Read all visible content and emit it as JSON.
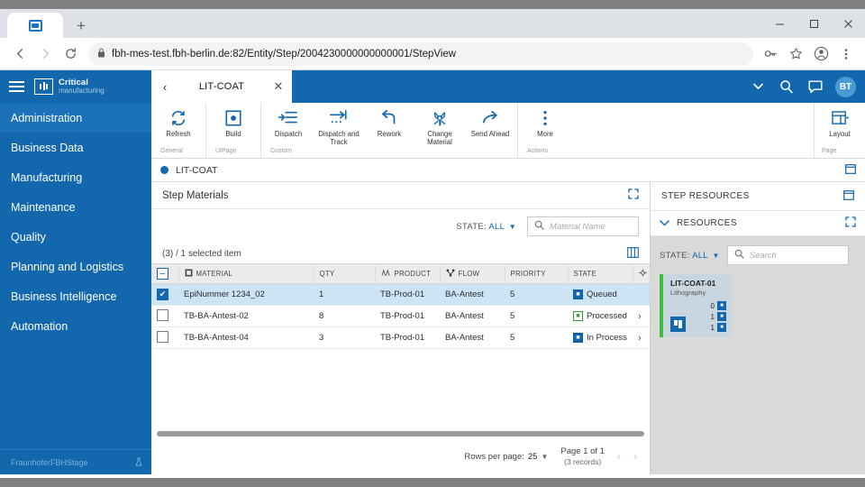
{
  "browser": {
    "tab_favicon": "app-favicon",
    "new_tab_label": "+",
    "window_controls": [
      "minimize",
      "maximize",
      "close"
    ],
    "url": "fbh-mes-test.fbh-berlin.de:82/Entity/Step/2004230000000000001/StepView",
    "lock_icon": "lock-icon",
    "nav": {
      "back": "back-icon",
      "forward": "forward-icon",
      "reload": "reload-icon"
    },
    "omni_icons": [
      "key-icon",
      "star-icon",
      "profile-icon",
      "menu-icon"
    ]
  },
  "sidebar": {
    "logo": {
      "line1": "Critical",
      "line2": "manufacturing"
    },
    "items": [
      {
        "label": "Administration",
        "active": true
      },
      {
        "label": "Business Data",
        "active": false
      },
      {
        "label": "Manufacturing",
        "active": false
      },
      {
        "label": "Maintenance",
        "active": false
      },
      {
        "label": "Quality",
        "active": false
      },
      {
        "label": "Planning and Logistics",
        "active": false
      },
      {
        "label": "Business Intelligence",
        "active": false
      },
      {
        "label": "Automation",
        "active": false
      }
    ],
    "footer": {
      "label": "FraunhoferFBHStage",
      "icon": "flask-icon"
    }
  },
  "topbar": {
    "tab_title": "LIT-COAT",
    "back_icon": "chevron-left-icon",
    "close_icon": "close-icon",
    "chevron_icon": "chevron-down-icon",
    "search_icon": "search-icon",
    "chat_icon": "chat-icon",
    "avatar_initials": "BT"
  },
  "ribbon": {
    "groups": [
      {
        "group_label": "General",
        "buttons": [
          {
            "label": "Refresh",
            "icon": "refresh-icon"
          }
        ]
      },
      {
        "group_label": "UIPage",
        "buttons": [
          {
            "label": "Build",
            "icon": "build-icon"
          }
        ]
      },
      {
        "group_label": "Custom",
        "buttons": [
          {
            "label": "Dispatch",
            "icon": "dispatch-icon"
          },
          {
            "label": "Dispatch and Track",
            "icon": "dispatch-track-icon"
          },
          {
            "label": "Rework",
            "icon": "rework-icon"
          },
          {
            "label": "Change Material",
            "icon": "change-material-icon"
          },
          {
            "label": "Send Ahead",
            "icon": "send-ahead-icon"
          }
        ]
      },
      {
        "group_label": "Actions",
        "buttons": [
          {
            "label": "More",
            "icon": "more-vertical-icon"
          }
        ]
      }
    ],
    "page_group": {
      "group_label": "Page",
      "buttons": [
        {
          "label": "Layout",
          "icon": "layout-icon"
        }
      ]
    }
  },
  "entity_header": {
    "name": "LIT-COAT",
    "status_dot_color": "#1267ad",
    "right_icon": "panel-icon"
  },
  "materials_panel": {
    "title": "Step Materials",
    "expand_icon": "expand-icon",
    "state_filter": {
      "prefix": "STATE:",
      "value": "ALL",
      "caret": "caret-down-icon"
    },
    "search": {
      "placeholder": "Material Name",
      "value": "",
      "icon": "search-icon"
    },
    "selection_text": "(3)  /  1 selected item",
    "columns_icon": "columns-icon",
    "columns": [
      {
        "label": "MATERIAL",
        "icon": "material-icon"
      },
      {
        "label": "QTY",
        "icon": ""
      },
      {
        "label": "PRODUCT",
        "icon": "product-icon"
      },
      {
        "label": "FLOW",
        "icon": "flow-icon"
      },
      {
        "label": "PRIORITY",
        "icon": ""
      },
      {
        "label": "STATE",
        "icon": ""
      },
      {
        "label": "",
        "icon": "settings-icon"
      }
    ],
    "rows": [
      {
        "selected": true,
        "material": "EpiNummer 1234_02",
        "qty": "1",
        "product": "TB-Prod-01",
        "flow": "BA-Antest",
        "priority": "5",
        "state": "Queued",
        "state_type": "blue",
        "has_chevron": false
      },
      {
        "selected": false,
        "material": "TB-BA-Antest-02",
        "qty": "8",
        "product": "TB-Prod-01",
        "flow": "BA-Antest",
        "priority": "5",
        "state": "Processed",
        "state_type": "green",
        "has_chevron": true
      },
      {
        "selected": false,
        "material": "TB-BA-Antest-04",
        "qty": "3",
        "product": "TB-Prod-01",
        "flow": "BA-Antest",
        "priority": "5",
        "state": "In Process",
        "state_type": "blue",
        "has_chevron": true
      }
    ],
    "pagination": {
      "rows_per_page_label": "Rows per page:",
      "rows_per_page_value": "25",
      "page_label": "Page 1 of 1",
      "records_label": "(3 records)",
      "prev_icon": "chevron-left-icon",
      "next_icon": "chevron-right-icon"
    }
  },
  "resources_panel": {
    "title": "STEP RESOURCES",
    "header_icon": "panel-icon",
    "section_title": "RESOURCES",
    "section_caret": "chevron-down-icon",
    "section_expand_icon": "expand-icon",
    "state_filter": {
      "prefix": "STATE:",
      "value": "ALL",
      "caret": "caret-down-icon"
    },
    "search": {
      "placeholder": "Search",
      "value": "",
      "icon": "search-icon"
    },
    "cards": [
      {
        "name": "LIT-COAT-01",
        "subtitle": "Lithography",
        "status_color": "#3dbd3d",
        "counters": [
          {
            "value": "0",
            "icon": "queued-icon"
          },
          {
            "value": "1",
            "icon": "in-process-icon"
          },
          {
            "value": "1",
            "icon": "processed-icon"
          }
        ]
      }
    ]
  },
  "colors": {
    "brand": "#1267ad",
    "sidebar_active": "#1c72b8",
    "row_selected": "#cde4f5",
    "green": "#3dbd3d"
  }
}
